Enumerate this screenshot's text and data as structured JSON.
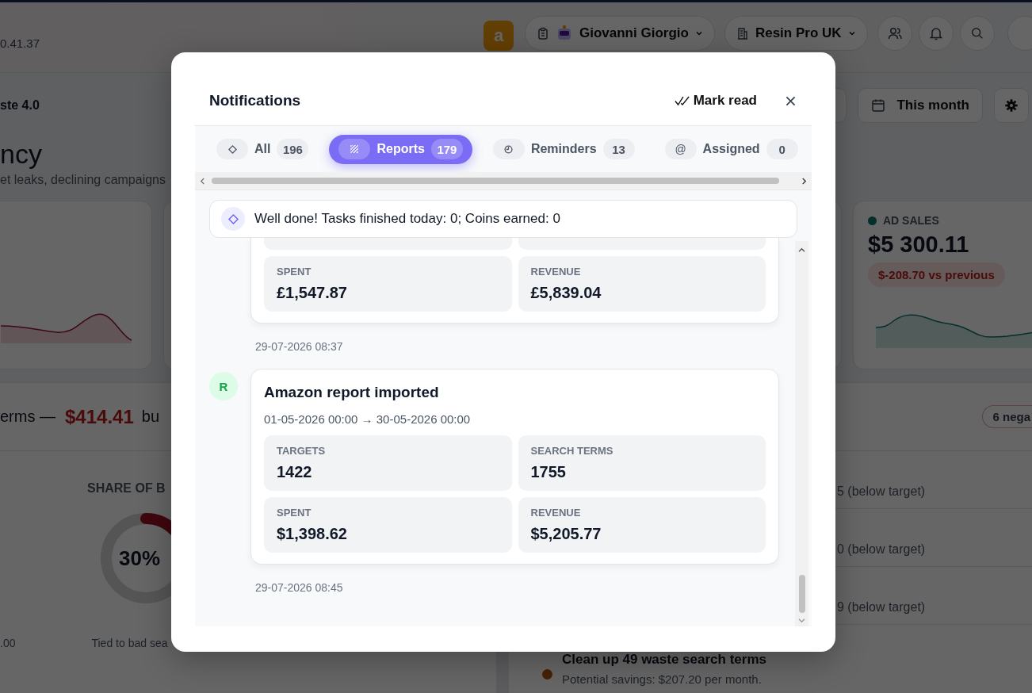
{
  "header": {
    "version": "0.41.37",
    "logo": "a",
    "user": "Giovanni Giorgio",
    "account": "Resin Pro UK"
  },
  "toolbar": {
    "title": "ste 4.0",
    "period": "This month"
  },
  "page": {
    "title": "ncy",
    "subtitle": "et leaks, declining campaigns"
  },
  "kpi_card": {
    "label": "AD SALES",
    "value": "$5 300.11",
    "change": "$-208.70 vs previous"
  },
  "waste": {
    "lead": "erms —",
    "amount": "$414.41",
    "trail": "bu",
    "badge": "6 nega",
    "share_title": "SHARE OF B",
    "share_value": "30%",
    "left_caption": ".00",
    "share_caption": "Tied to bad sea"
  },
  "insights": [
    {
      "text": "5 (below target)"
    },
    {
      "text": "0 (below target)"
    },
    {
      "text": "9 (below target)"
    }
  ],
  "action": {
    "title": "Clean up 49 waste search terms",
    "detail": "Potential savings: $207.20 per month."
  },
  "notifications": {
    "title": "Notifications",
    "mark_read": "Mark read",
    "tabs": [
      {
        "label": "All",
        "count": "196",
        "selected": false
      },
      {
        "label": "Reports",
        "count": "179",
        "selected": true
      },
      {
        "label": "Reminders",
        "count": "13",
        "selected": false
      },
      {
        "label": "Assigned",
        "count": "0",
        "symbol": "@",
        "selected": false
      }
    ],
    "banner": "Well done! Tasks finished today: 0; Coins earned: 0",
    "items": [
      {
        "kind": "partial",
        "stats": [
          {
            "label": "SPENT",
            "value": "£1,547.87"
          },
          {
            "label": "REVENUE",
            "value": "£5,839.04"
          }
        ],
        "time": "29-07-2026 08:37"
      },
      {
        "kind": "full",
        "avatar": "R",
        "title": "Amazon report imported",
        "range": "01-05-2026 00:00 → 30-05-2026 00:00",
        "stats": [
          {
            "label": "TARGETS",
            "value": "1422"
          },
          {
            "label": "SEARCH TERMS",
            "value": "1755"
          },
          {
            "label": "SPENT",
            "value": "$1,398.62"
          },
          {
            "label": "REVENUE",
            "value": "$5,205.77"
          }
        ],
        "time": "29-07-2026 08:45"
      }
    ]
  }
}
